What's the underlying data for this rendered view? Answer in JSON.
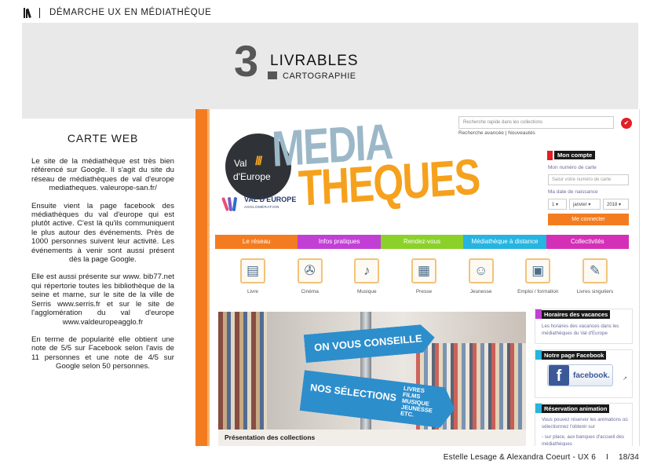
{
  "header": {
    "title": "DÉMARCHE UX EN MÉDIATHÈQUE"
  },
  "section": {
    "number": "3",
    "title": "LIVRABLES",
    "subtitle": "CARTOGRAPHIE"
  },
  "left": {
    "heading": "CARTE WEB",
    "paragraphs": [
      "Le site de la médiathèque est très bien référencé sur Google. Il s'agit du site du réseau de médiathèques de val d'europe mediatheques. valeurope-san.fr/",
      "Ensuite vient la page facebook des médiathèques du val d'europe qui est plutôt active. C'est là qu'ils communiquent le plus autour des événements. Près de 1000 personnes suivent leur activité. Les événements à venir sont aussi présent dès la page Google.",
      "Elle est aussi présente sur www. bib77.net qui répertorie toutes les bibliothèque de la seine et marne, sur le site de la ville de Serris www.serris.fr  et sur le site de l'agglomération du val d'europe www.valdeuropeagglo.fr",
      "En terme de popularité elle obtient une note de 5/5 sur Facebook selon l'avis de 11 personnes et une note de 4/5 sur Google selon 50 personnes."
    ]
  },
  "site": {
    "search_placeholder": "Recherche rapide dans les collections",
    "search_links": "Recherche avancée  |  Nouveautés",
    "logo": {
      "val": "Val",
      "slashes": "///",
      "europe": "d'Europe",
      "brand_top": "VAL D'EUROPE",
      "brand_bottom": "AGGLOMÉRATION",
      "word1": "MEDIA",
      "word2": "THEQUES"
    },
    "account": {
      "title": "Mon compte",
      "card_label": "Mon numéro de carte",
      "card_placeholder": "Saisir votre numéro de carte",
      "birth_label": "Ma date de naissance",
      "day": "1",
      "month": "janvier",
      "year": "2018",
      "login": "Me connecter"
    },
    "nav": [
      {
        "label": "Le réseau",
        "color": "#f47c20"
      },
      {
        "label": "Infos pratiques",
        "color": "#c23fd6"
      },
      {
        "label": "Rendez-vous",
        "color": "#8bd12a"
      },
      {
        "label": "Médiathèque à distance",
        "color": "#26b4e0"
      },
      {
        "label": "Collectivités",
        "color": "#d42fb7"
      }
    ],
    "categories": [
      {
        "label": "Livre",
        "icon": "book-icon",
        "glyph": "▤"
      },
      {
        "label": "Cinéma",
        "icon": "film-reel-icon",
        "glyph": "✇"
      },
      {
        "label": "Musique",
        "icon": "music-icon",
        "glyph": "♪"
      },
      {
        "label": "Presse",
        "icon": "newspaper-icon",
        "glyph": "▦"
      },
      {
        "label": "Jeunesse",
        "icon": "child-icon",
        "glyph": "☺"
      },
      {
        "label": "Emploi / formation",
        "icon": "employment-icon",
        "glyph": "▣"
      },
      {
        "label": "Livres singuliers",
        "icon": "tablet-icon",
        "glyph": "✎"
      }
    ],
    "hero": {
      "sign1": "ON VOUS CONSEILLE",
      "sign2": "NOS SÉLECTIONS",
      "sign2_list": [
        "LIVRES",
        "FILMS",
        "MUSIQUE",
        "JEUNESSE",
        "ETC."
      ],
      "caption": "Présentation des collections"
    },
    "boxes": {
      "holidays_title": "Horaires des vacances",
      "holidays_text": "Les horaires des vacances dans les médiathèques du Val d'Europe",
      "facebook_title": "Notre page Facebook",
      "facebook_word": "facebook.",
      "booking_title": "Réservation animation",
      "booking_text1": "Vous pouvez réserver les animations où sélectionnez l'obtenir sur",
      "booking_text2": "- sur place, aux banques d'accueil des médiathèques"
    }
  },
  "footer": {
    "authors": "Estelle Lesage & Alexandra Coeurt - UX 6",
    "separator": "I",
    "page": "18/34"
  },
  "colors": {
    "orange": "#f47c20",
    "banner": "#e9e9e9",
    "section_number": "#575757"
  }
}
